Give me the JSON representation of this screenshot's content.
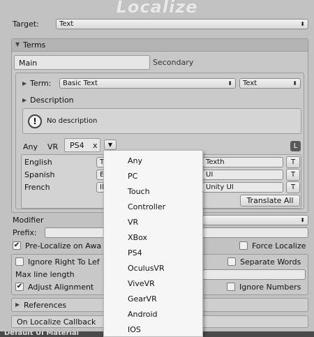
{
  "header": {
    "title": "Localize"
  },
  "target": {
    "label": "Target:",
    "value": "Text"
  },
  "terms": {
    "header": "Terms",
    "tabs": {
      "main": "Main",
      "secondary": "Secondary"
    },
    "term": {
      "label": "Term:",
      "value": "Basic Text",
      "type_value": "Text"
    },
    "description": {
      "label": "Description",
      "text": "No description"
    },
    "filters": {
      "any": "Any",
      "vr": "VR",
      "ps4_tag": "PS4",
      "tag_close": "x",
      "lock": "L"
    },
    "languages": [
      {
        "name": "English",
        "value": "T",
        "translation": "Texth",
        "t_btn": "T"
      },
      {
        "name": "Spanish",
        "value": "E",
        "translation": "UI",
        "t_btn": "T"
      },
      {
        "name": "French",
        "value": "Il",
        "translation": "Unity UI",
        "t_btn": "T"
      }
    ],
    "translate_all": "Translate All"
  },
  "modifier": {
    "label": "Modifier"
  },
  "prefix": {
    "label": "Prefix:"
  },
  "options": {
    "pre_localize": "Pre-Localize on Awa",
    "force_localize": "Force Localize",
    "ignore_rtl": "Ignore Right To Lef",
    "separate_words": "Separate Words",
    "max_line_length": "Max line length",
    "adjust_alignment": "Adjust Alignment",
    "ignore_numbers": "Ignore Numbers"
  },
  "references": {
    "label": "References"
  },
  "callback": {
    "label": "On Localize Callback"
  },
  "footer": {
    "label": "Default UI Material"
  },
  "popup_menu": {
    "items": [
      "Any",
      "PC",
      "Touch",
      "Controller",
      "VR",
      "XBox",
      "PS4",
      "OculusVR",
      "ViveVR",
      "GearVR",
      "Android",
      "IOS"
    ]
  }
}
